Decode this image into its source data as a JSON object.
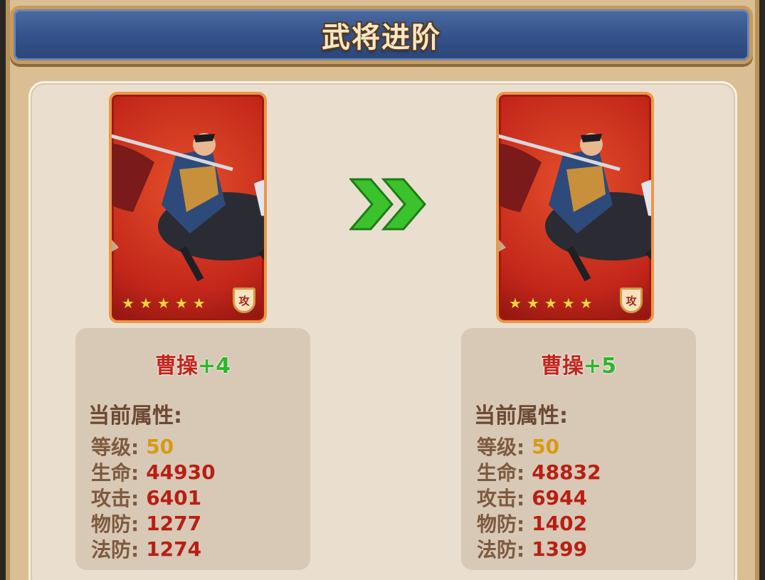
{
  "title": "武将进阶",
  "before": {
    "name": "曹操",
    "plus": "+4",
    "stars": 5,
    "type_badge": "攻",
    "section_title": "当前属性:",
    "attributes": [
      {
        "label": "等级:",
        "value": "50"
      },
      {
        "label": "生命:",
        "value": "44930"
      },
      {
        "label": "攻击:",
        "value": "6401"
      },
      {
        "label": "物防:",
        "value": "1277"
      },
      {
        "label": "法防:",
        "value": "1274"
      }
    ]
  },
  "after": {
    "name": "曹操",
    "plus": "+5",
    "stars": 5,
    "type_badge": "攻",
    "section_title": "当前属性:",
    "attributes": [
      {
        "label": "等级:",
        "value": "50"
      },
      {
        "label": "生命:",
        "value": "48832"
      },
      {
        "label": "攻击:",
        "value": "6944"
      },
      {
        "label": "物防:",
        "value": "1402"
      },
      {
        "label": "法防:",
        "value": "1399"
      }
    ]
  },
  "icons": {
    "arrow": "double-chevron-right-icon",
    "star": "star-icon"
  },
  "colors": {
    "name": "#c0261b",
    "plus": "#2fb52a",
    "value": "#b81f14",
    "level": "#d99a12",
    "label": "#7d5a3e"
  }
}
